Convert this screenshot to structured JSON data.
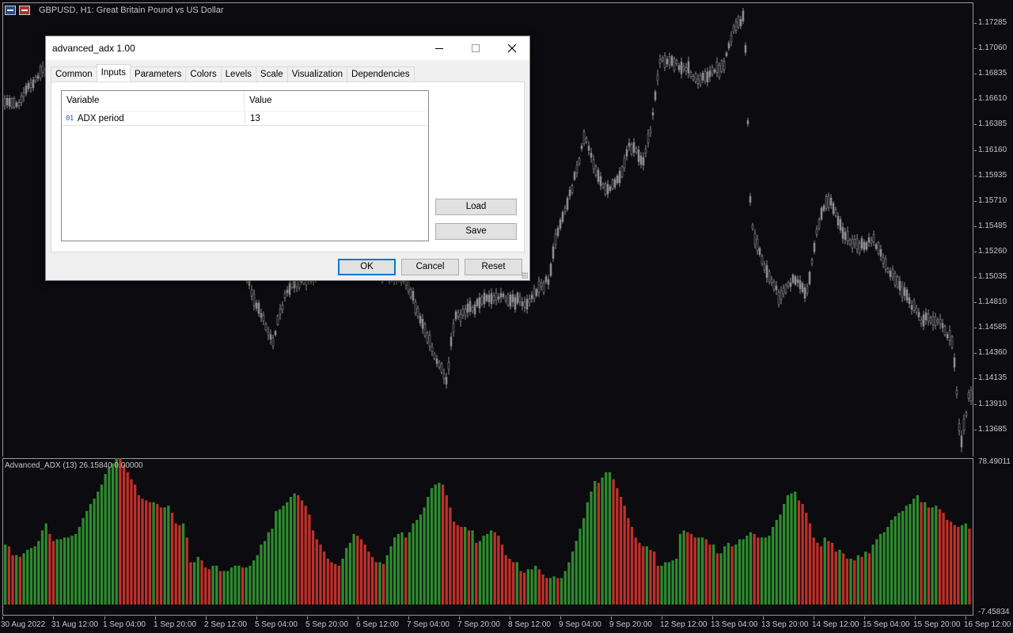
{
  "chart": {
    "title": "GBPUSD, H1:  Great Britain Pound vs US Dollar",
    "icons": [
      "chart-list-icon",
      "signal-icon"
    ],
    "price_labels": [
      "1.17285",
      "1.17060",
      "1.16835",
      "1.16610",
      "1.16385",
      "1.16160",
      "1.15935",
      "1.15710",
      "1.15485",
      "1.15260",
      "1.15035",
      "1.14810",
      "1.14585",
      "1.14360",
      "1.14135",
      "1.13910",
      "1.13685"
    ],
    "time_labels": [
      "30 Aug 2022",
      "31 Aug 12:00",
      "1 Sep 04:00",
      "1 Sep 20:00",
      "2 Sep 12:00",
      "5 Sep 04:00",
      "5 Sep 20:00",
      "6 Sep 12:00",
      "7 Sep 04:00",
      "7 Sep 20:00",
      "8 Sep 12:00",
      "9 Sep 04:00",
      "9 Sep 20:00",
      "12 Sep 12:00",
      "13 Sep 04:00",
      "13 Sep 20:00",
      "14 Sep 12:00",
      "15 Sep 04:00",
      "15 Sep 20:00",
      "16 Sep 12:00"
    ],
    "candle_color": "#8c8c8c",
    "background": "#0b0b10"
  },
  "indicator": {
    "title": "Advanced_ADX (13) 26.15840 0.00000",
    "axis_labels": [
      "78.49011",
      "-7.45834"
    ],
    "bull_color": "#2e8b2e",
    "bear_color": "#c0302a"
  },
  "dialog": {
    "title": "advanced_adx 1.00",
    "tabs": [
      "Common",
      "Inputs",
      "Parameters",
      "Colors",
      "Levels",
      "Scale",
      "Visualization",
      "Dependencies"
    ],
    "active_tab": "Inputs",
    "table": {
      "headers": [
        "Variable",
        "Value"
      ],
      "rows": [
        {
          "icon": "01",
          "variable": "ADX period",
          "value": "13"
        }
      ]
    },
    "buttons": {
      "load": "Load",
      "save": "Save",
      "ok": "OK",
      "cancel": "Cancel",
      "reset": "Reset"
    }
  },
  "chart_data": {
    "type": "bar",
    "title": "Advanced_ADX (13) 26.15840 0.00000",
    "ylim": [
      -7.45834,
      78.49011
    ],
    "series": [
      {
        "values": [
          34,
          33,
          28,
          28,
          27,
          29,
          31,
          32,
          33,
          36,
          42,
          46,
          40,
          36,
          37,
          37,
          38,
          38,
          39,
          40,
          44,
          49,
          53,
          57,
          60,
          64,
          68,
          74,
          78,
          80,
          84,
          83,
          79,
          75,
          71,
          68,
          62,
          60,
          59,
          58,
          58,
          57,
          55,
          55,
          56,
          52,
          46,
          45,
          46,
          38,
          24,
          24,
          27,
          25,
          21,
          20,
          22,
          22,
          19,
          19,
          19,
          21,
          22,
          22,
          21,
          21,
          22,
          25,
          28,
          34,
          36,
          41,
          43,
          53,
          54,
          56,
          58,
          61,
          63,
          62,
          59,
          56,
          51,
          42,
          37,
          34,
          30,
          26,
          24,
          23,
          22,
          26,
          32,
          35,
          40,
          39,
          37,
          34,
          30,
          27,
          24,
          24,
          23,
          28,
          33,
          38,
          40,
          41,
          38,
          41,
          46,
          48,
          51,
          55,
          61,
          66,
          68,
          69,
          68,
          62,
          55,
          47,
          45,
          44,
          44,
          42,
          42,
          35,
          36,
          39,
          40,
          42,
          41,
          39,
          34,
          28,
          26,
          24,
          24,
          19,
          18,
          20,
          20,
          22,
          20,
          17,
          15,
          15,
          16,
          15,
          15,
          19,
          24,
          30,
          36,
          43,
          49,
          58,
          64,
          70,
          69,
          72,
          75,
          75,
          71,
          66,
          61,
          56,
          49,
          44,
          38,
          35,
          33,
          33,
          31,
          30,
          22,
          22,
          24,
          24,
          25,
          26,
          40,
          42,
          41,
          40,
          38,
          38,
          38,
          37,
          34,
          34,
          29,
          29,
          33,
          35,
          33,
          34,
          37,
          37,
          39,
          41,
          40,
          38,
          38,
          38,
          39,
          44,
          48,
          51,
          57,
          62,
          63,
          64,
          59,
          57,
          52,
          46,
          38,
          35,
          33,
          38,
          36,
          35,
          30,
          31,
          29,
          26,
          26,
          25,
          28,
          27,
          30,
          29,
          34,
          37,
          40,
          41,
          44,
          48,
          50,
          52,
          53,
          56,
          57,
          60,
          62,
          58,
          58,
          55,
          55,
          56,
          54,
          52,
          48,
          47,
          45,
          44,
          45,
          46,
          43
        ]
      }
    ]
  }
}
